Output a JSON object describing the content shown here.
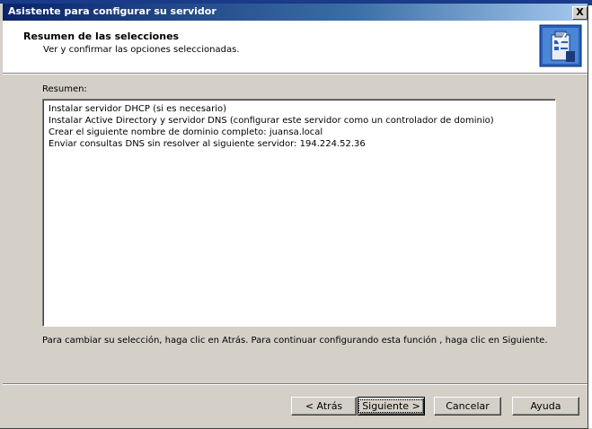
{
  "window": {
    "title": "Asistente para configurar su servidor",
    "close_glyph": "X"
  },
  "header": {
    "title": "Resumen de las selecciones",
    "subtitle": "Ver y confirmar las opciones seleccionadas.",
    "icon": "wizard-checklist-icon"
  },
  "summary": {
    "label": "Resumen:",
    "lines": [
      "Instalar servidor DHCP (si es necesario)",
      "Instalar Active Directory y servidor DNS (configurar este servidor como un controlador de dominio)",
      "Crear el siguiente nombre de dominio completo: juansa.local",
      "Enviar consultas DNS sin resolver al siguiente servidor: 194.224.52.36"
    ]
  },
  "note": "Para cambiar su selección, haga clic en Atrás. Para continuar configurando esta función , haga clic en Siguiente.",
  "buttons": {
    "back": "< Atrás",
    "next": "Siguiente >",
    "cancel": "Cancelar",
    "help": "Ayuda"
  },
  "colors": {
    "titlebar_start": "#0a246a",
    "titlebar_end": "#a6caf0",
    "face": "#d4d0c8"
  }
}
